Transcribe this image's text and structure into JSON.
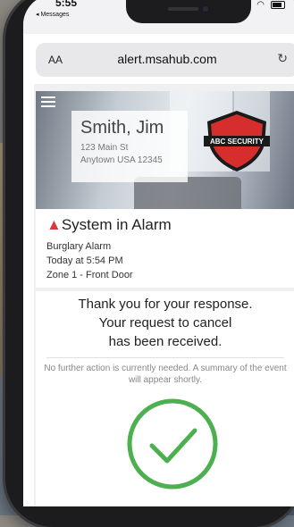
{
  "status_bar": {
    "time": "5:55",
    "back_label": "◂ Messages"
  },
  "browser": {
    "text_size_label": "AA",
    "url": "alert.msahub.com",
    "reload_icon": "reload-icon"
  },
  "account": {
    "name": "Smith, Jim",
    "address_line1": "123 Main St",
    "address_line2": "Anytown USA 12345"
  },
  "brand": {
    "logo_text": "ABC SECURITY",
    "color": "#d62d2d"
  },
  "alarm": {
    "title": "System in Alarm",
    "type": "Burglary Alarm",
    "time": "Today at 5:54 PM",
    "zone": "Zone 1 - Front Door",
    "alert_color": "#d43c3c"
  },
  "response": {
    "line1": "Thank you for your response.",
    "line2": "Your request to cancel",
    "line3": "has been received.",
    "note": "No further action is currently needed. A summary of the event will appear shortly.",
    "check_color": "#4caf50"
  }
}
